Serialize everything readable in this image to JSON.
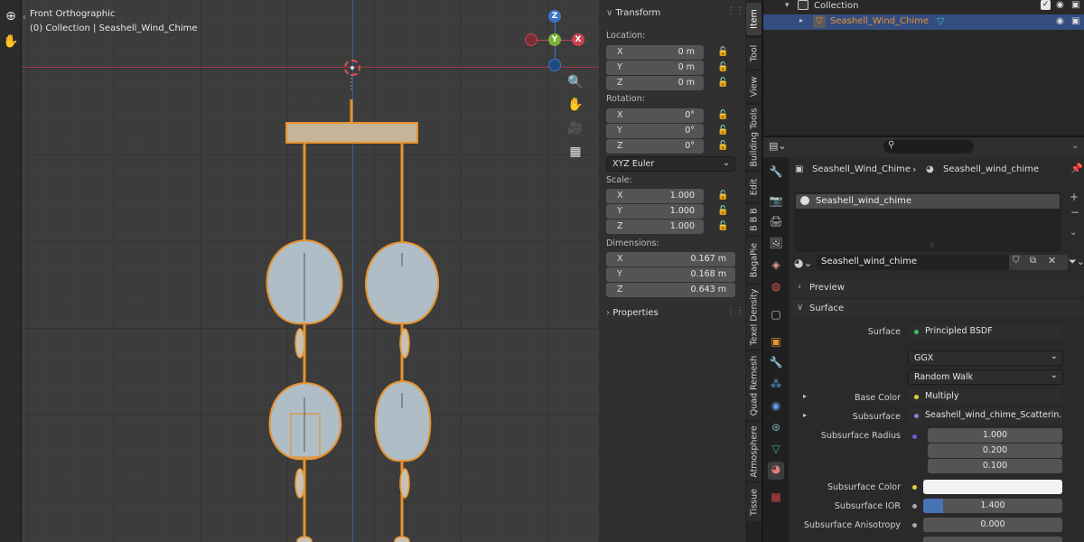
{
  "viewport": {
    "view_name": "Front Orthographic",
    "view_context": "(0) Collection | Seashell_Wind_Chime",
    "gizmo": {
      "z": "Z",
      "y": "Y",
      "x": "X"
    }
  },
  "npanel": {
    "transform_title": "Transform",
    "location_label": "Location:",
    "location": [
      {
        "axis": "X",
        "value": "0 m"
      },
      {
        "axis": "Y",
        "value": "0 m"
      },
      {
        "axis": "Z",
        "value": "0 m"
      }
    ],
    "rotation_label": "Rotation:",
    "rotation": [
      {
        "axis": "X",
        "value": "0°"
      },
      {
        "axis": "Y",
        "value": "0°"
      },
      {
        "axis": "Z",
        "value": "0°"
      }
    ],
    "rotation_mode": "XYZ Euler",
    "scale_label": "Scale:",
    "scale": [
      {
        "axis": "X",
        "value": "1.000"
      },
      {
        "axis": "Y",
        "value": "1.000"
      },
      {
        "axis": "Z",
        "value": "1.000"
      }
    ],
    "dimensions_label": "Dimensions:",
    "dimensions": [
      {
        "axis": "X",
        "value": "0.167 m"
      },
      {
        "axis": "Y",
        "value": "0.168 m"
      },
      {
        "axis": "Z",
        "value": "0.643 m"
      }
    ],
    "properties_title": "Properties"
  },
  "vtabs": [
    "Item",
    "Tool",
    "View",
    "Building Tools",
    "Edit",
    "B B B",
    "BagaPie",
    "Texel Density",
    "Quad Remesh",
    "Atmosphere",
    "Tissue"
  ],
  "outliner": {
    "collection": "Collection",
    "object": "Seashell_Wind_Chime"
  },
  "properties": {
    "breadcrumb_object": "Seashell_Wind_Chime",
    "breadcrumb_material": "Seashell_wind_chime",
    "slot_name": "Seashell_wind_chime",
    "material_name": "Seashell_wind_chime",
    "preview_title": "Preview",
    "surface_title": "Surface",
    "surface_label": "Surface",
    "surface_value": "Principled BSDF",
    "distribution": "GGX",
    "subsurface_method": "Random Walk",
    "base_color_label": "Base Color",
    "base_color_value": "Multiply",
    "subsurface_label": "Subsurface",
    "subsurface_value": "Seashell_wind_chime_Scatterin...",
    "subsurface_radius_label": "Subsurface Radius",
    "subsurface_radius": [
      "1.000",
      "0.200",
      "0.100"
    ],
    "subsurface_color_label": "Subsurface Color",
    "subsurface_ior_label": "Subsurface IOR",
    "subsurface_ior_value": "1.400",
    "subsurface_ior_fill": 0.14,
    "subsurface_aniso_label": "Subsurface Anisotropy",
    "subsurface_aniso_value": "0.000"
  },
  "colors": {
    "selection_orange": "#e8922c",
    "active_row_blue": "#334d80",
    "x_axis": "#a23a48",
    "z_axis": "#3a5e96"
  }
}
